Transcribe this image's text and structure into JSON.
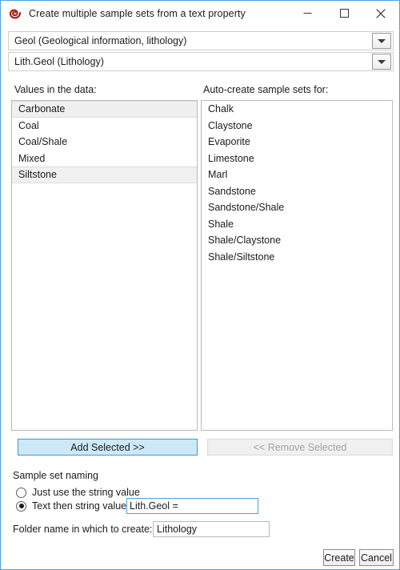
{
  "window": {
    "title": "Create multiple sample sets from a text property",
    "icon": "app-swirl-icon",
    "accent_color": "#4aa3e0",
    "controls": {
      "minimize": "minimize-icon",
      "maximize": "maximize-icon",
      "close": "close-icon"
    }
  },
  "combos": [
    {
      "name": "property-combo",
      "value": "Geol (Geological information, lithology)",
      "arrow_icon": "chevron-down-icon"
    },
    {
      "name": "template-combo",
      "value": "Lith.Geol (Lithology)",
      "arrow_icon": "chevron-down-icon"
    }
  ],
  "lists": {
    "values": {
      "label": "Values in the data:",
      "items": [
        {
          "label": "Carbonate",
          "selected": true
        },
        {
          "label": "Coal",
          "selected": false
        },
        {
          "label": "Coal/Shale",
          "selected": false
        },
        {
          "label": "Mixed",
          "selected": false
        },
        {
          "label": "Siltstone",
          "selected": true
        }
      ]
    },
    "targets": {
      "label": "Auto-create sample sets for:",
      "items": [
        {
          "label": "Chalk",
          "selected": false
        },
        {
          "label": "Claystone",
          "selected": false
        },
        {
          "label": "Evaporite",
          "selected": false
        },
        {
          "label": "Limestone",
          "selected": false
        },
        {
          "label": "Marl",
          "selected": false
        },
        {
          "label": "Sandstone",
          "selected": false
        },
        {
          "label": "Sandstone/Shale",
          "selected": false
        },
        {
          "label": "Shale",
          "selected": false
        },
        {
          "label": "Shale/Claystone",
          "selected": false
        },
        {
          "label": "Shale/Siltstone",
          "selected": false
        }
      ]
    }
  },
  "transfer": {
    "add_label": "Add Selected >>",
    "remove_label": "<< Remove Selected",
    "add_highlight_color": "#cde9f9",
    "remove_disabled": true
  },
  "naming": {
    "group_label": "Sample set naming",
    "option_plain_label": "Just use the string value",
    "option_plain_checked": false,
    "option_text_label": "Text then string value",
    "option_text_checked": true,
    "prefix_value": "Lith.Geol =",
    "prefix_placeholder": "",
    "folder_label": "Folder name in which to create:",
    "folder_value": "Lithology",
    "folder_placeholder": ""
  },
  "actions": {
    "create_label": "Create",
    "cancel_label": "Cancel"
  }
}
